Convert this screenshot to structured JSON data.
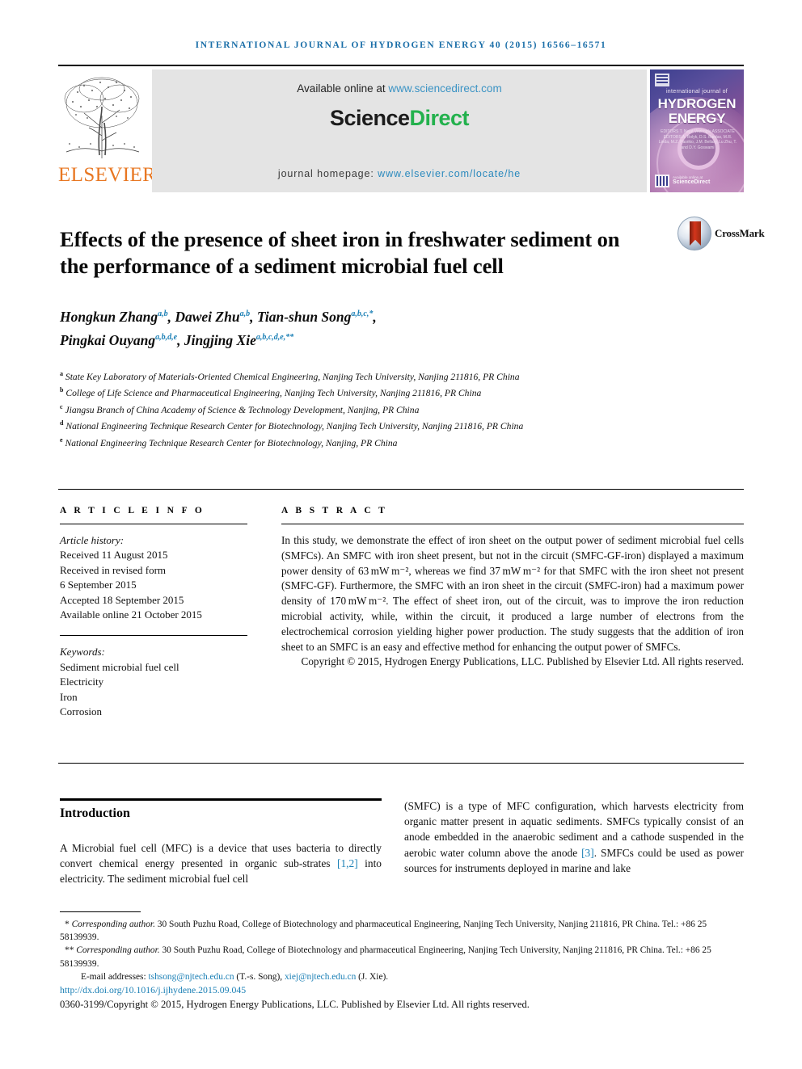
{
  "running_head": "INTERNATIONAL JOURNAL OF HYDROGEN ENERGY 40 (2015) 16566–16571",
  "masthead": {
    "elsevier_wordmark": "ELSEVIER",
    "available_prefix": "Available online at ",
    "available_link": "www.sciencedirect.com",
    "brand_part1": "Science",
    "brand_part2": "Direct",
    "homepage_prefix": "journal homepage: ",
    "homepage_link": "www.elsevier.com/locate/he",
    "cover": {
      "kicker": "international journal of",
      "line1": "HYDROGEN",
      "line2": "ENERGY",
      "editors": "EDITORS  T. Nejat Veziroglu\nASSOCIATE EDITORS  A. Bolyk, D.S. Bardas, M.R. Linda,\nM.Z. Pasriko, J.M. Bellary,\nLu Zhu, T. and D.Y. Goswami",
      "sd_label": "ScienceDirect",
      "sd_sub": "Available online at"
    }
  },
  "colors": {
    "link": "#1a7fb5",
    "running_head": "#1a6ea8",
    "elsevier_orange": "#e87722",
    "sciencedirect_green": "#23b14d"
  },
  "article": {
    "title": "Effects of the presence of sheet iron in freshwater sediment on the performance of a sediment microbial fuel cell",
    "crossmark_label": "CrossMark",
    "authors": [
      {
        "name": "Hongkun Zhang",
        "marks": "a,b",
        "sep": ", "
      },
      {
        "name": "Dawei Zhu",
        "marks": "a,b",
        "sep": ", "
      },
      {
        "name": "Tian-shun Song",
        "marks": "a,b,c,*",
        "sep": ", "
      },
      {
        "name": "Pingkai Ouyang",
        "marks": "a,b,d,e",
        "sep": ", "
      },
      {
        "name": "Jingjing Xie",
        "marks": "a,b,c,d,e,**",
        "sep": ""
      }
    ],
    "affiliations": [
      {
        "mark": "a",
        "text": "State Key Laboratory of Materials-Oriented Chemical Engineering, Nanjing Tech University, Nanjing 211816, PR China"
      },
      {
        "mark": "b",
        "text": "College of Life Science and Pharmaceutical Engineering, Nanjing Tech University, Nanjing 211816, PR China"
      },
      {
        "mark": "c",
        "text": "Jiangsu Branch of China Academy of Science & Technology Development, Nanjing, PR China"
      },
      {
        "mark": "d",
        "text": "National Engineering Technique Research Center for Biotechnology, Nanjing Tech University, Nanjing 211816, PR China"
      },
      {
        "mark": "e",
        "text": "National Engineering Technique Research Center for Biotechnology, Nanjing, PR China"
      }
    ]
  },
  "article_info": {
    "heading": "A R T I C L E   I N F O",
    "history_label": "Article history:",
    "history": [
      "Received 11 August 2015",
      "Received in revised form",
      "6 September 2015",
      "Accepted 18 September 2015",
      "Available online 21 October 2015"
    ],
    "keywords_label": "Keywords:",
    "keywords": [
      "Sediment microbial fuel cell",
      "Electricity",
      "Iron",
      "Corrosion"
    ]
  },
  "abstract": {
    "heading": "A B S T R A C T",
    "text": "In this study, we demonstrate the effect of iron sheet on the output power of sediment microbial fuel cells (SMFCs). An SMFC with iron sheet present, but not in the circuit (SMFC-GF-iron) displayed a maximum power density of 63 mW m⁻², whereas we find 37 mW m⁻² for that SMFC with the iron sheet not present (SMFC-GF). Furthermore, the SMFC with an iron sheet in the circuit (SMFC-iron) had a maximum power density of 170 mW m⁻². The effect of sheet iron, out of the circuit, was to improve the iron reduction microbial activity, while, within the circuit, it produced a large number of electrons from the electrochemical corrosion yielding higher power production. The study suggests that the addition of iron sheet to an SMFC is an easy and effective method for enhancing the output power of SMFCs.",
    "copyright": "Copyright © 2015, Hydrogen Energy Publications, LLC. Published by Elsevier Ltd. All rights reserved."
  },
  "introduction": {
    "heading": "Introduction",
    "left_par_1": "A Microbial fuel cell (MFC) is a device that uses bacteria to directly convert chemical energy presented in organic sub-strates ",
    "left_ref_1": "[1,2]",
    "left_par_2": " into electricity. The sediment microbial fuel cell",
    "right_par_1": "(SMFC) is a type of MFC configuration, which harvests electricity from organic matter present in aquatic sediments. SMFCs typically consist of an anode embedded in the anaerobic sediment and a cathode suspended in the aerobic water column above the anode ",
    "right_ref_1": "[3]",
    "right_par_2": ". SMFCs could be used as power sources for instruments deployed in marine and lake"
  },
  "footnotes": {
    "note1_marker": "*",
    "note1_italic": "Corresponding author.",
    "note1_text": " 30 South Puzhu Road, College of Biotechnology and pharmaceutical Engineering, Nanjing Tech University, Nanjing 211816, PR China. Tel.: +86 25 58139939.",
    "note2_marker": "**",
    "note2_italic": "Corresponding author.",
    "note2_text": " 30 South Puzhu Road, College of Biotechnology and pharmaceutical Engineering, Nanjing Tech University, Nanjing 211816, PR China. Tel.: +86 25 58139939.",
    "email_label": "E-mail addresses: ",
    "email1": "tshsong@njtech.edu.cn",
    "email1_who": " (T.-s. Song), ",
    "email2": "xiej@njtech.edu.cn",
    "email2_who": " (J. Xie).",
    "doi": "http://dx.doi.org/10.1016/j.ijhydene.2015.09.045",
    "issn": "0360-3199/Copyright © 2015, Hydrogen Energy Publications, LLC. Published by Elsevier Ltd. All rights reserved."
  }
}
